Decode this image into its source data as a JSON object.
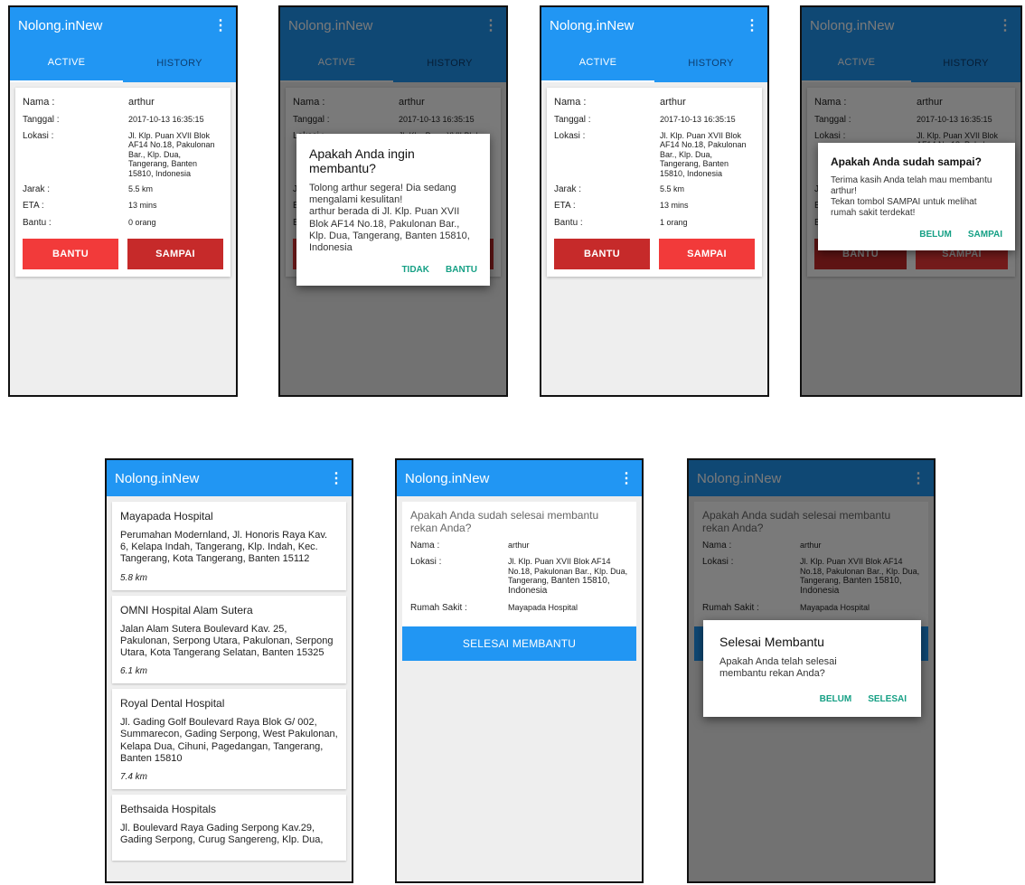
{
  "app": {
    "title": "Nolong.inNew",
    "menu_icon": "⋮"
  },
  "tabs": {
    "active": "ACTIVE",
    "history": "HISTORY"
  },
  "labels": {
    "nama": "Nama :",
    "tanggal": "Tanggal :",
    "lokasi": "Lokasi :",
    "jarak": "Jarak :",
    "eta": "ETA :",
    "bantu": "Bantu :"
  },
  "request": {
    "nama": "arthur",
    "tanggal": "2017-10-13 16:35:15",
    "lokasi": "Jl. Klp. Puan XVII Blok AF14 No.18, Pakulonan Bar., Klp. Dua, Tangerang, Banten 15810, Indonesia",
    "jarak": "5.5 km",
    "eta": "13 mins",
    "bantu_before": "0 orang",
    "bantu_after": "1 orang"
  },
  "buttons": {
    "bantu": "BANTU",
    "sampai": "SAMPAI"
  },
  "dialog_bantu": {
    "title": "Apakah Anda ingin membantu?",
    "message": "Tolong arthur segera! Dia sedang mengalami kesulitan!\narthur berada di Jl. Klp. Puan XVII Blok AF14 No.18, Pakulonan Bar., Klp. Dua, Tangerang, Banten 15810, Indonesia",
    "negative": "TIDAK",
    "positive": "BANTU"
  },
  "dialog_sampai": {
    "title": "Apakah Anda sudah sampai?",
    "message": "Terima kasih Anda telah mau membantu arthur!\nTekan tombol SAMPAI untuk melihat rumah sakit terdekat!",
    "negative": "BELUM",
    "positive": "SAMPAI"
  },
  "hospitals": [
    {
      "name": "Mayapada Hospital",
      "address": "Perumahan Modernland, Jl. Honoris Raya Kav. 6, Kelapa Indah, Tangerang, Klp. Indah, Kec. Tangerang, Kota Tangerang, Banten 15112",
      "distance": "5.8 km"
    },
    {
      "name": "OMNI Hospital Alam Sutera",
      "address": "Jalan Alam Sutera Boulevard Kav. 25, Pakulonan, Serpong Utara, Pakulonan, Serpong Utara, Kota Tangerang Selatan, Banten 15325",
      "distance": "6.1 km"
    },
    {
      "name": "Royal Dental Hospital",
      "address": "Jl. Gading Golf Boulevard Raya Blok G/ 002, Summarecon, Gading Serpong, West Pakulonan, Kelapa Dua, Cihuni, Pagedangan, Tangerang, Banten 15810",
      "distance": "7.4 km"
    },
    {
      "name": "Bethsaida Hospitals",
      "address": "Jl. Boulevard Raya Gading Serpong Kav.29, Gading Serpong, Curug Sangereng, Klp. Dua,",
      "distance": ""
    }
  ],
  "finish": {
    "title": "Apakah Anda sudah selesai membantu rekan Anda?",
    "nama_label": "Nama :",
    "nama": "arthur",
    "lokasi_label": "Lokasi :",
    "lokasi_part1": "Jl. Klp. Puan XVII Blok AF14 No.18, Pakulonan Bar., Klp. Dua, Tangerang,",
    "lokasi_part2": "Banten 15810, Indonesia",
    "rs_label": "Rumah Sakit :",
    "rs": "Mayapada Hospital",
    "button": "SELESAI MEMBANTU"
  },
  "dialog_selesai": {
    "title": "Selesai Membantu",
    "message": "Apakah Anda telah selesai membantu rekan Anda?",
    "negative": "BELUM",
    "positive": "SELESAI"
  },
  "colors": {
    "primary": "#2196f3",
    "red": "#f23a3a",
    "dark_red": "#c62a2a",
    "dialog_action": "#16a085"
  }
}
